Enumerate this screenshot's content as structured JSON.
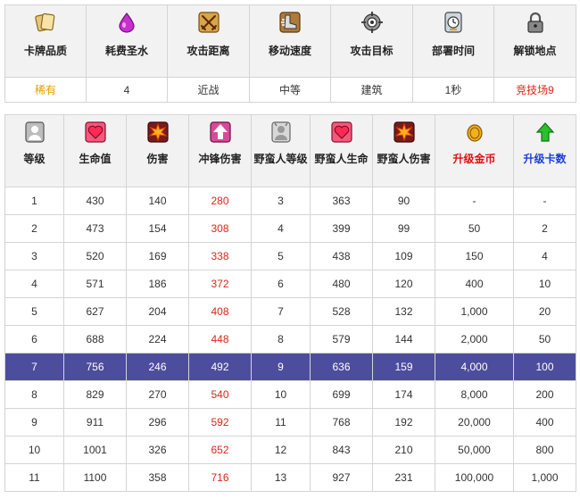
{
  "info": {
    "headers": [
      "卡牌品质",
      "耗费圣水",
      "攻击距离",
      "移动速度",
      "攻击目标",
      "部署时间",
      "解锁地点"
    ],
    "icons": [
      "cards-icon",
      "elixir-drop-icon",
      "crossed-swords-icon",
      "boot-speed-icon",
      "target-icon",
      "clock-icon",
      "lock-icon"
    ],
    "values": [
      "稀有",
      "4",
      "近战",
      "中等",
      "建筑",
      "1秒",
      "竞技场9"
    ],
    "rarity_color": "#e0a000",
    "unlock_color": "#d9261c"
  },
  "stats": {
    "headers": [
      "等级",
      "生命值",
      "伤害",
      "冲锋伤害",
      "野蛮人等级",
      "野蛮人生命",
      "野蛮人伤害",
      "升级金币",
      "升级卡数"
    ],
    "icons": [
      "level-person-icon",
      "heart-icon",
      "explosion-icon",
      "charge-arrow-icon",
      "barbarian-person-icon",
      "heart-icon",
      "explosion-icon",
      "gold-coin-icon",
      "green-arrow-up-icon"
    ],
    "gold_header_color": "#e01010",
    "cards_header_color": "#1a3fd6",
    "highlight_color": "#4d4d9e",
    "rows": [
      [
        "1",
        "430",
        "140",
        "280",
        "3",
        "363",
        "90",
        "-",
        "-"
      ],
      [
        "2",
        "473",
        "154",
        "308",
        "4",
        "399",
        "99",
        "50",
        "2"
      ],
      [
        "3",
        "520",
        "169",
        "338",
        "5",
        "438",
        "109",
        "150",
        "4"
      ],
      [
        "4",
        "571",
        "186",
        "372",
        "6",
        "480",
        "120",
        "400",
        "10"
      ],
      [
        "5",
        "627",
        "204",
        "408",
        "7",
        "528",
        "132",
        "1,000",
        "20"
      ],
      [
        "6",
        "688",
        "224",
        "448",
        "8",
        "579",
        "144",
        "2,000",
        "50"
      ],
      [
        "7",
        "756",
        "246",
        "492",
        "9",
        "636",
        "159",
        "4,000",
        "100"
      ],
      [
        "8",
        "829",
        "270",
        "540",
        "10",
        "699",
        "174",
        "8,000",
        "200"
      ],
      [
        "9",
        "911",
        "296",
        "592",
        "11",
        "768",
        "192",
        "20,000",
        "400"
      ],
      [
        "10",
        "1001",
        "326",
        "652",
        "12",
        "843",
        "210",
        "50,000",
        "800"
      ],
      [
        "11",
        "1100",
        "358",
        "716",
        "13",
        "927",
        "231",
        "100,000",
        "1,000"
      ]
    ],
    "selected_row": 6
  }
}
